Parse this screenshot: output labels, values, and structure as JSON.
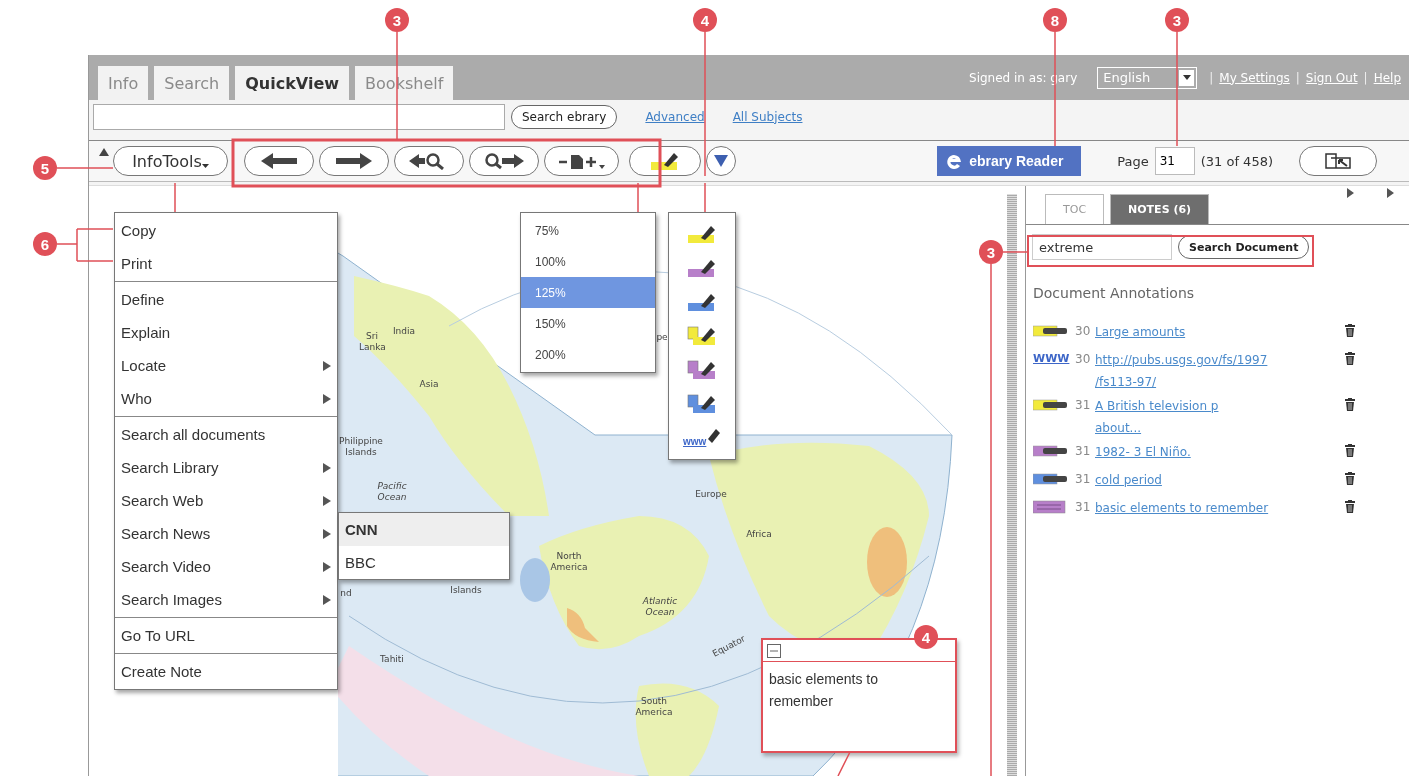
{
  "tabs": [
    {
      "label": "Info",
      "selected": false
    },
    {
      "label": "Search",
      "selected": false
    },
    {
      "label": "QuickView",
      "selected": true
    },
    {
      "label": "Bookshelf",
      "selected": false
    }
  ],
  "account": {
    "signed_in": "Signed in as: gary",
    "language": "English",
    "links": [
      {
        "separator": "|",
        "label": "My Settings"
      },
      {
        "separator": "|",
        "label": "Sign Out"
      },
      {
        "separator": "|",
        "label": "Help"
      }
    ]
  },
  "search": {
    "button": "Search ebrary",
    "links": [
      "Advanced",
      "All Subjects"
    ]
  },
  "toolbar": {
    "infotools": "InfoTools",
    "reader": "ebrary Reader",
    "page_label": "Page",
    "page_value": "31",
    "page_count": "(31 of 458)"
  },
  "infotools_menu": [
    [
      {
        "label": "Copy",
        "submenu": false
      },
      {
        "label": "Print",
        "submenu": false
      }
    ],
    [
      {
        "label": "Define",
        "submenu": false
      },
      {
        "label": "Explain",
        "submenu": false
      },
      {
        "label": "Locate",
        "submenu": true
      },
      {
        "label": "Who",
        "submenu": true
      }
    ],
    [
      {
        "label": "Search all documents",
        "submenu": false
      },
      {
        "label": "Search Library",
        "submenu": true
      },
      {
        "label": "Search Web",
        "submenu": true
      },
      {
        "label": "Search News",
        "submenu": true
      },
      {
        "label": "Search Video",
        "submenu": true
      },
      {
        "label": "Search Images",
        "submenu": true
      }
    ],
    [
      {
        "label": "Go To URL",
        "submenu": false
      }
    ],
    [
      {
        "label": "Create Note",
        "submenu": false
      }
    ]
  ],
  "news_submenu": [
    {
      "label": "CNN",
      "selected": true
    },
    {
      "label": "BBC",
      "selected": false
    }
  ],
  "zoom_menu": [
    {
      "label": "75%",
      "selected": false
    },
    {
      "label": "100%",
      "selected": false
    },
    {
      "label": "125%",
      "selected": true
    },
    {
      "label": "150%",
      "selected": false
    },
    {
      "label": "200%",
      "selected": false
    }
  ],
  "highlight_menu": [
    {
      "kind": "highlight",
      "color": "#f2ea3c"
    },
    {
      "kind": "highlight",
      "color": "#b77fc9"
    },
    {
      "kind": "highlight",
      "color": "#5f8fde"
    },
    {
      "kind": "note",
      "color": "#f2ea3c"
    },
    {
      "kind": "note",
      "color": "#b77fc9"
    },
    {
      "kind": "note",
      "color": "#5f8fde"
    },
    {
      "kind": "link",
      "label": "www"
    }
  ],
  "map_labels": [
    "Sri Lanka",
    "India",
    "Asia",
    "Philippine Islands",
    "Pacific Ocean",
    "Islands",
    "Tahiti",
    "North America",
    "Europe",
    "Africa",
    "Atlantic Ocean",
    "Equator",
    "South America",
    "nd",
    "pe"
  ],
  "note_popup": {
    "text": "basic elements to remember"
  },
  "panel": {
    "tabs": [
      {
        "label": "TOC",
        "selected": false
      },
      {
        "label": "NOTES (6)",
        "selected": true
      }
    ],
    "search_value": "extreme",
    "search_button": "Search Document",
    "heading": "Document Annotations",
    "annotations": [
      {
        "kind": "highlight",
        "color": "#f2ea3c",
        "page": "30",
        "lines": [
          "Large amounts"
        ]
      },
      {
        "kind": "link",
        "label": "WWW",
        "page": "30",
        "lines": [
          "http://pubs.usgs.gov/fs/1997",
          "/fs113-97/"
        ]
      },
      {
        "kind": "highlight",
        "color": "#f2ea3c",
        "page": "31",
        "lines": [
          "A British television p",
          "about..."
        ]
      },
      {
        "kind": "highlight",
        "color": "#b77fc9",
        "page": "31",
        "lines": [
          "1982- 3 El Niño."
        ]
      },
      {
        "kind": "highlight",
        "color": "#5f8fde",
        "page": "31",
        "lines": [
          "cold period"
        ]
      },
      {
        "kind": "note",
        "color": "#b77fc9",
        "page": "31",
        "lines": [
          "basic elements to remember"
        ]
      }
    ]
  },
  "callouts": [
    "3",
    "4",
    "8",
    "3",
    "5",
    "6",
    "3",
    "4"
  ]
}
